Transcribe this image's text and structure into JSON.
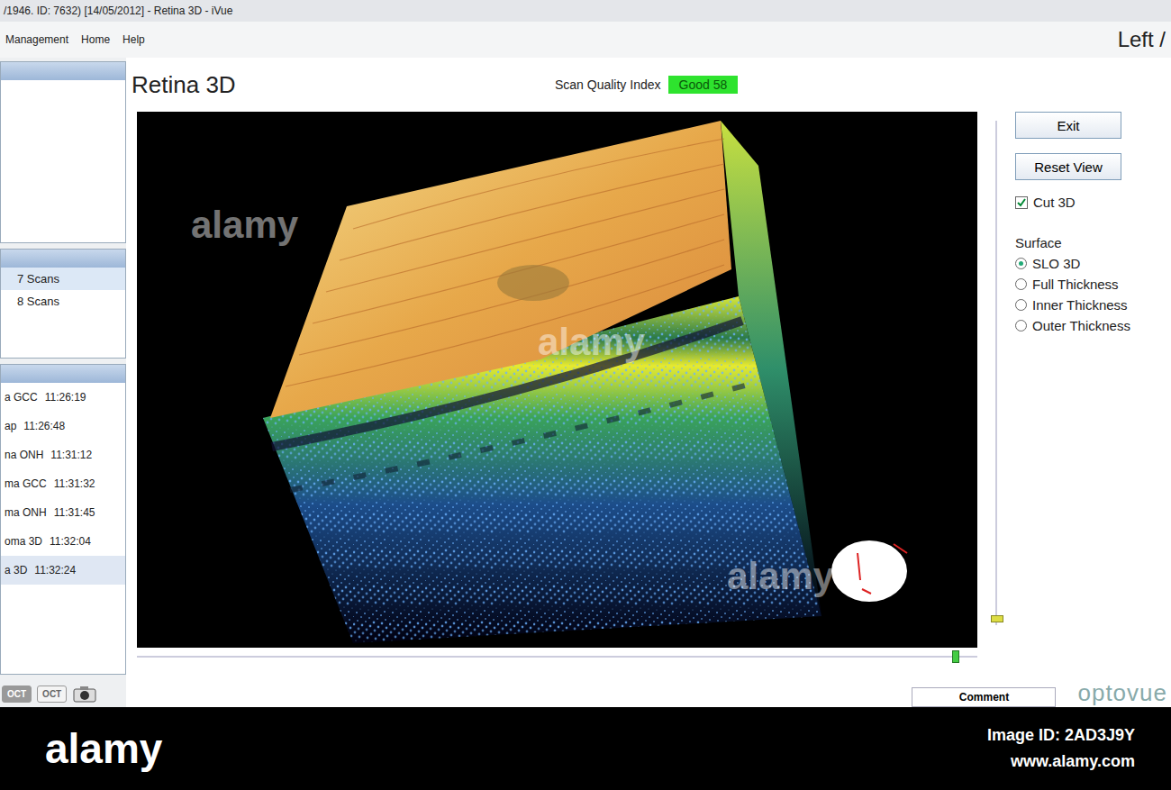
{
  "window": {
    "title": "/1946. ID: 7632) [14/05/2012] - Retina 3D - iVue",
    "eye": "Left /"
  },
  "menu": [
    "Management",
    "Home",
    "Help"
  ],
  "scans": [
    {
      "label": "7 Scans",
      "selected": true
    },
    {
      "label": "8 Scans",
      "selected": false
    }
  ],
  "sessions": [
    {
      "name": "a GCC",
      "time": "11:26:19",
      "selected": false
    },
    {
      "name": "ap",
      "time": "11:26:48",
      "selected": false
    },
    {
      "name": "na ONH",
      "time": "11:31:12",
      "selected": false
    },
    {
      "name": "ma GCC",
      "time": "11:31:32",
      "selected": false
    },
    {
      "name": "ma ONH",
      "time": "11:31:45",
      "selected": false
    },
    {
      "name": "oma 3D",
      "time": "11:32:04",
      "selected": false
    },
    {
      "name": "a 3D",
      "time": "11:32:24",
      "selected": true
    }
  ],
  "mode_buttons": [
    {
      "label": "OCT",
      "selected": true
    },
    {
      "label": "OCT",
      "selected": false
    }
  ],
  "panel": {
    "title": "Retina 3D",
    "quality_label": "Scan Quality Index",
    "quality": "Good  58"
  },
  "controls": {
    "buttons": [
      "Exit",
      "Reset View"
    ],
    "cut3d": {
      "label": "Cut 3D",
      "checked": true
    },
    "surface_label": "Surface",
    "surface": [
      {
        "label": "SLO 3D",
        "selected": true
      },
      {
        "label": "Full Thickness",
        "selected": false
      },
      {
        "label": "Inner Thickness",
        "selected": false
      },
      {
        "label": "Outer Thickness",
        "selected": false
      }
    ]
  },
  "view_slider": {
    "level": 0.97
  },
  "depth_slider": {
    "level": 0.98
  },
  "comment": "Comment",
  "brand": "optovue",
  "watermark": "alamy",
  "stock_bar": {
    "logo": "alamy",
    "image_id": "Image ID: 2AD3J9Y",
    "url": "www.alamy.com"
  }
}
